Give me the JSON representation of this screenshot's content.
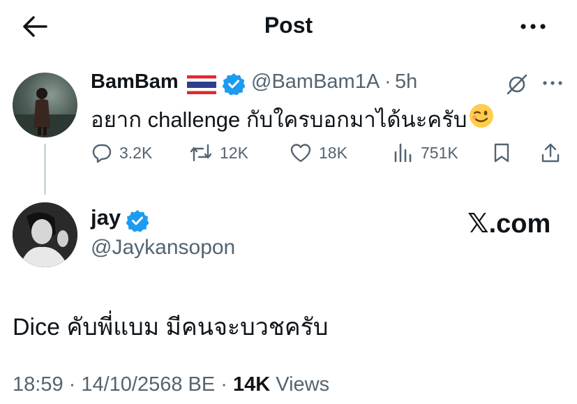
{
  "header": {
    "title": "Post"
  },
  "original_post": {
    "author_name": "BamBam",
    "handle": "@BamBam1A",
    "separator": "·",
    "time": "5h",
    "text": "อยาก challenge กับใครบอกมาได้นะครับ",
    "actions": {
      "replies": "3.2K",
      "reposts": "12K",
      "likes": "18K",
      "views": "751K"
    }
  },
  "reply_post": {
    "author_name": "jay",
    "handle": "@Jaykansopon",
    "watermark": "𝕏.com",
    "text": "Dice คับพี่แบม มีคนจะบวชครับ",
    "meta": {
      "time": "18:59",
      "separator1": " · ",
      "date": "14/10/2568 BE",
      "separator2": " · ",
      "views_count": "14K",
      "views_label": " Views"
    }
  },
  "colors": {
    "text_primary": "#0f1419",
    "text_secondary": "#536471",
    "verified_blue": "#1d9bf0",
    "thread_line": "#cfd9de"
  }
}
